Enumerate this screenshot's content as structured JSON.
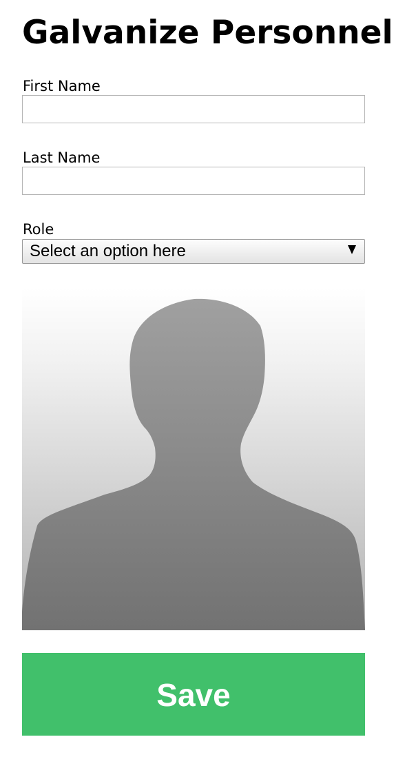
{
  "page": {
    "title": "Galvanize Personnel"
  },
  "form": {
    "first_name": {
      "label": "First Name",
      "value": ""
    },
    "last_name": {
      "label": "Last Name",
      "value": ""
    },
    "role": {
      "label": "Role",
      "selected": "Select an option here"
    },
    "save_label": "Save"
  },
  "avatar": {
    "icon": "person-silhouette-icon"
  },
  "colors": {
    "save_button": "#41c06b",
    "save_text": "#ffffff",
    "silhouette_top": "#a0a0a0",
    "silhouette_bottom": "#727272"
  }
}
